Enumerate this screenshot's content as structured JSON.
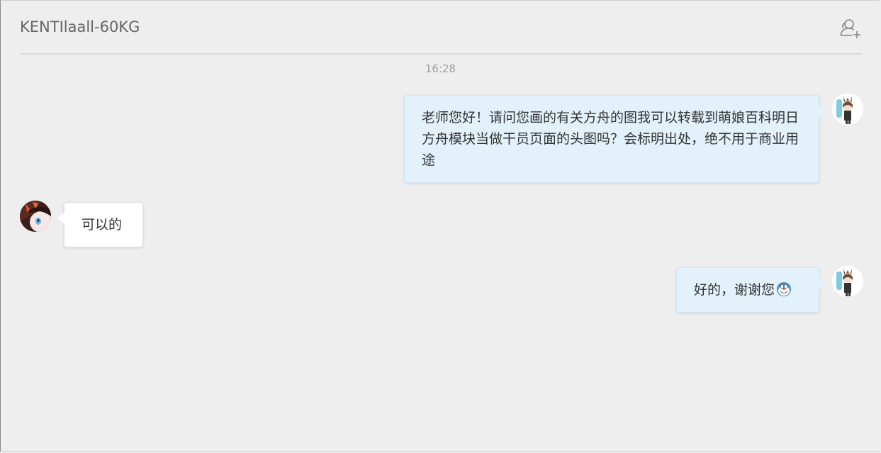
{
  "chat": {
    "title": "KENTIlaall-60KG",
    "add_member_icon": "add-user-icon"
  },
  "timestamp": "16:28",
  "messages": [
    {
      "side": "out",
      "text": "老师您好！请问您画的有关方舟的图我可以转载到萌娘百科明日方舟模块当做干员页面的头图吗？会标明出处，绝不用于商业用途"
    },
    {
      "side": "in",
      "text": "可以的"
    },
    {
      "side": "out",
      "text": "好的，谢谢您",
      "emoji": "doraemon-emoji"
    }
  ],
  "colors": {
    "background": "#eeeeee",
    "outgoing_bubble": "#e3f1fb",
    "incoming_bubble": "#ffffff",
    "title_text": "#666666",
    "timestamp_text": "#a0a0a0"
  }
}
